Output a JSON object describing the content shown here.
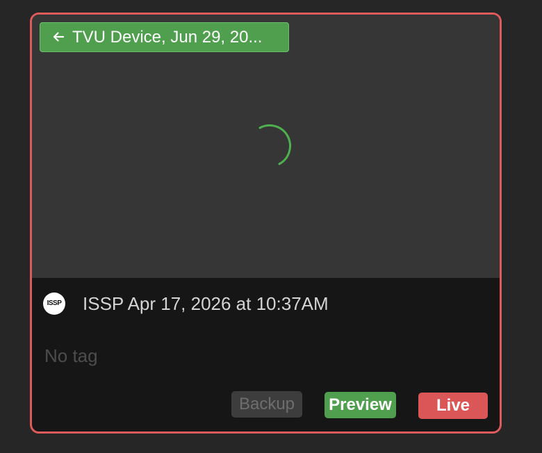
{
  "source": {
    "label": "TVU Device, Jun 29, 20...",
    "icon": "arrow-left-icon",
    "color": "#4f9f4f"
  },
  "player": {
    "status_icon": "loading-spinner-icon",
    "spinner_color": "#4fb04f"
  },
  "stream": {
    "logo_text": "ISSP",
    "title": "ISSP Apr 17, 2026 at 10:37AM",
    "tag": "No tag"
  },
  "actions": {
    "backup_label": "Backup",
    "preview_label": "Preview",
    "live_label": "Live"
  },
  "colors": {
    "border": "#df5b5b",
    "preview": "#4f9f4f",
    "live": "#db5757",
    "backup_disabled": "#3d3d3d"
  }
}
